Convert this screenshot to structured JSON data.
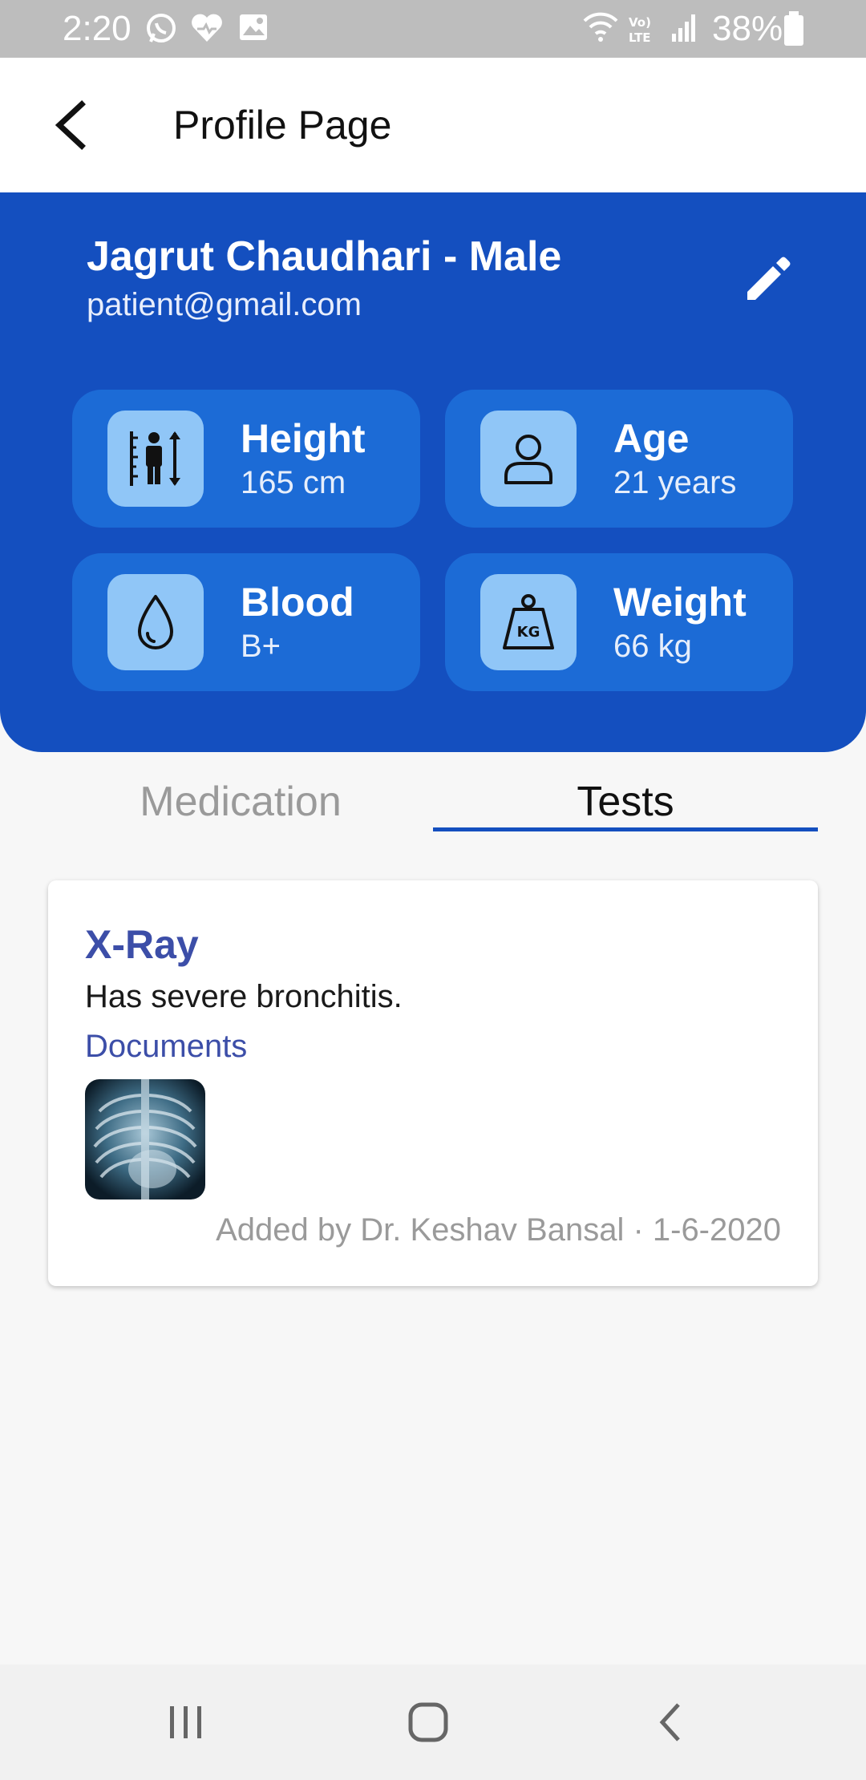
{
  "status_bar": {
    "time": "2:20",
    "battery": "38%",
    "icons": [
      "whatsapp-icon",
      "health-icon",
      "gallery-icon",
      "wifi-icon",
      "volte-icon",
      "signal-icon",
      "battery-icon"
    ]
  },
  "app_bar": {
    "title": "Profile Page",
    "back_icon": "chevron-left-icon"
  },
  "profile": {
    "name_line": "Jagrut Chaudhari - Male",
    "email": "patient@gmail.com",
    "edit_icon": "pencil-icon",
    "stats": [
      {
        "label": "Height",
        "value": "165 cm",
        "icon": "height-icon"
      },
      {
        "label": "Age",
        "value": "21 years",
        "icon": "person-icon"
      },
      {
        "label": "Blood",
        "value": "B+",
        "icon": "blood-drop-icon"
      },
      {
        "label": "Weight",
        "value": "66 kg",
        "icon": "weight-icon"
      }
    ]
  },
  "tabs": [
    {
      "label": "Medication",
      "active": false
    },
    {
      "label": "Tests",
      "active": true
    }
  ],
  "test_card": {
    "title": "X-Ray",
    "description": "Has severe bronchitis.",
    "documents_label": "Documents",
    "footer": "Added by Dr. Keshav Bansal · 1-6-2020"
  },
  "nav_bar": {
    "icons": [
      "recent-apps-icon",
      "home-icon",
      "back-icon"
    ]
  },
  "colors": {
    "header_blue": "#144fbf",
    "card_blue": "#1c6bd6",
    "icon_box": "#90c6f7",
    "accent_text": "#3c4ea8"
  }
}
